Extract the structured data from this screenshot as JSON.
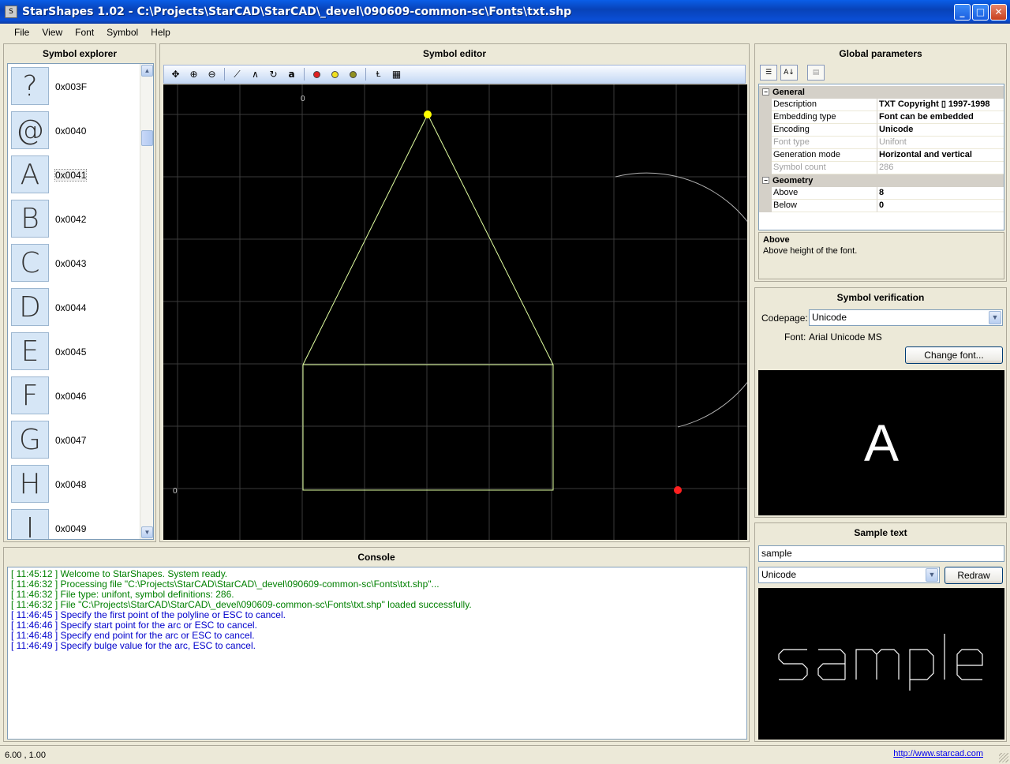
{
  "window": {
    "title": "StarShapes 1.02 - C:\\Projects\\StarCAD\\StarCAD\\_devel\\090609-common-sc\\Fonts\\txt.shp",
    "minimize": "_",
    "maximize": "□",
    "close": "✕"
  },
  "menu": [
    "File",
    "View",
    "Font",
    "Symbol",
    "Help"
  ],
  "explorer": {
    "title": "Symbol explorer",
    "items": [
      {
        "glyph": "?",
        "code": "0x003F"
      },
      {
        "glyph": "@",
        "code": "0x0040"
      },
      {
        "glyph": "A",
        "code": "0x0041"
      },
      {
        "glyph": "B",
        "code": "0x0042"
      },
      {
        "glyph": "C",
        "code": "0x0043"
      },
      {
        "glyph": "D",
        "code": "0x0044"
      },
      {
        "glyph": "E",
        "code": "0x0045"
      },
      {
        "glyph": "F",
        "code": "0x0046"
      },
      {
        "glyph": "G",
        "code": "0x0047"
      },
      {
        "glyph": "H",
        "code": "0x0048"
      },
      {
        "glyph": "I",
        "code": "0x0049"
      }
    ],
    "selected": "0x0041"
  },
  "editor": {
    "title": "Symbol editor",
    "toolbar_icons": [
      "pan-icon",
      "zoom-in-icon",
      "zoom-out-icon",
      "line-tool-icon",
      "polyline-tool-icon",
      "arc-tool-icon",
      "text-tool-icon",
      "red-point-icon",
      "yellow-point-icon",
      "olive-point-icon",
      "baseline-icon",
      "grid-icon"
    ],
    "text_tool_label": "a",
    "axis_label_x_origin": "0",
    "axis_label_y_origin": "0",
    "colors": {
      "stroke": "#e0ffa0",
      "grid": "#3a3a3a",
      "start_point": "#ffff00",
      "end_point": "#ff0000"
    }
  },
  "globals": {
    "title": "Global parameters",
    "categories": [
      {
        "name": "General",
        "rows": [
          {
            "key": "Description",
            "value": "TXT  Copyright ▯ 1997-1998",
            "dim": false
          },
          {
            "key": "Embedding type",
            "value": "Font can be embedded",
            "dim": false
          },
          {
            "key": "Encoding",
            "value": "Unicode",
            "dim": false
          },
          {
            "key": "Font type",
            "value": "Unifont",
            "dim": true
          },
          {
            "key": "Generation mode",
            "value": "Horizontal and vertical",
            "dim": false
          },
          {
            "key": "Symbol count",
            "value": "286",
            "dim": true
          }
        ]
      },
      {
        "name": "Geometry",
        "rows": [
          {
            "key": "Above",
            "value": "8",
            "dim": false
          },
          {
            "key": "Below",
            "value": "0",
            "dim": false
          }
        ]
      }
    ],
    "help_title": "Above",
    "help_text": "Above height of the font."
  },
  "verification": {
    "title": "Symbol verification",
    "codepage_label": "Codepage:",
    "codepage_value": "Unicode",
    "font_label": "Font:",
    "font_value": "Arial Unicode MS",
    "change_font_button": "Change font...",
    "preview_glyph": "A"
  },
  "sample": {
    "title": "Sample text",
    "text_value": "sample",
    "encoding_value": "Unicode",
    "redraw_button": "Redraw"
  },
  "console": {
    "title": "Console",
    "lines": [
      {
        "text": "[ 11:45:12 ] Welcome to StarShapes. System ready.",
        "color": "#008000"
      },
      {
        "text": "[ 11:46:32 ] Processing file \"C:\\Projects\\StarCAD\\StarCAD\\_devel\\090609-common-sc\\Fonts\\txt.shp\"...",
        "color": "#008000"
      },
      {
        "text": "[ 11:46:32 ] File type: unifont, symbol definitions: 286.",
        "color": "#008000"
      },
      {
        "text": "[ 11:46:32 ] File \"C:\\Projects\\StarCAD\\StarCAD\\_devel\\090609-common-sc\\Fonts\\txt.shp\" loaded successfully.",
        "color": "#008000"
      },
      {
        "text": "[ 11:46:45 ] Specify the first point of the polyline or ESC to cancel.",
        "color": "#0000cc"
      },
      {
        "text": "[ 11:46:46 ] Specify start point for the arc or ESC to cancel.",
        "color": "#0000cc"
      },
      {
        "text": "[ 11:46:48 ] Specify end point for the arc or ESC to cancel.",
        "color": "#0000cc"
      },
      {
        "text": "[ 11:46:49 ] Specify bulge value for the arc, ESC to cancel.",
        "color": "#0000cc"
      }
    ]
  },
  "status": {
    "coords": "6.00 , 1.00",
    "link": "http://www.starcad.com"
  }
}
